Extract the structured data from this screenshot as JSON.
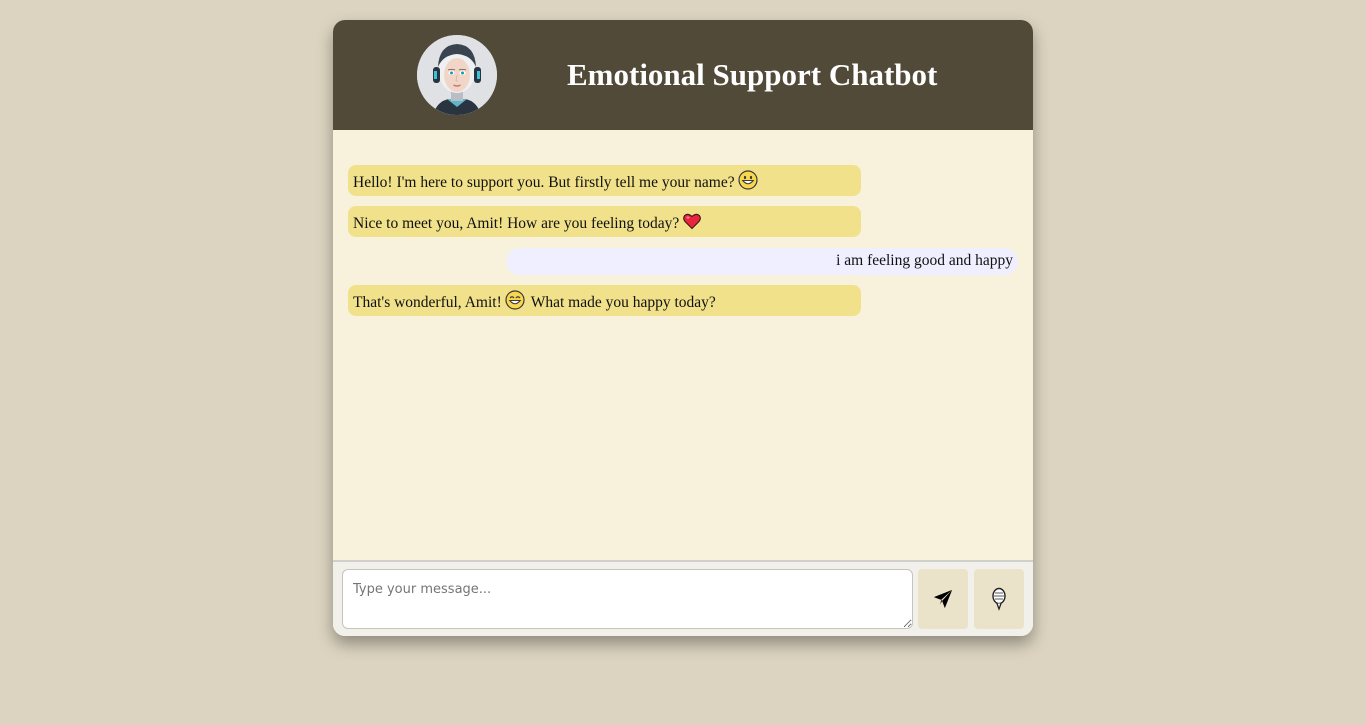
{
  "header": {
    "title": "Emotional Support Chatbot",
    "avatar_icon": "robot-avatar-icon",
    "background_color": "#514a38"
  },
  "messages": [
    {
      "sender": "bot",
      "text": "Hello! I'm here to support you. But firstly tell me your name?",
      "emoji": "😀"
    },
    {
      "sender": "bot",
      "text": "Nice to meet you, Amit! How are you feeling today?",
      "emoji": "❤️"
    },
    {
      "sender": "user",
      "text": "i am feeling good and happy",
      "emoji": ""
    },
    {
      "sender": "bot",
      "text": "That's wonderful, Amit!",
      "emoji": "😄",
      "text_after": "What made you happy today?"
    }
  ],
  "input": {
    "placeholder": "Type your message...",
    "value": ""
  },
  "buttons": {
    "send_icon": "send-icon",
    "mic_icon": "microphone-icon"
  },
  "colors": {
    "page_background": "#dcd4c0",
    "chat_background": "#f8f1dc",
    "bot_bubble": "#f0e18a",
    "user_bubble": "#efefff",
    "button_background": "#ebe3c9"
  }
}
